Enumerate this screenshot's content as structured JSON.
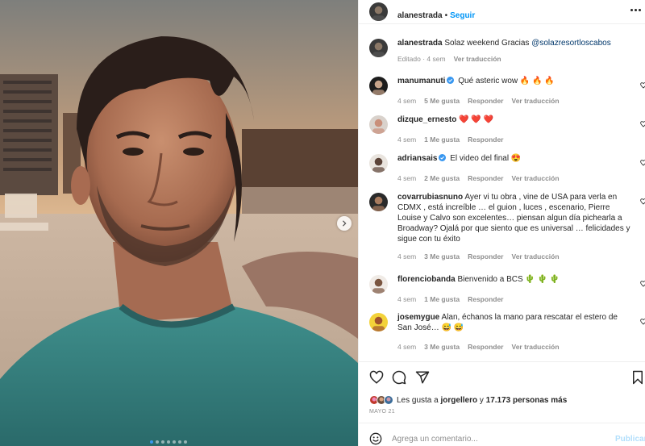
{
  "header": {
    "username": "alanestrada",
    "separator": "•",
    "follow_label": "Seguir"
  },
  "caption": {
    "username": "alanestrada",
    "text": "Solaz weekend Gracias",
    "mention": "@solazresortloscabos",
    "edited": "Editado",
    "time": "4 sem",
    "translate": "Ver traducción"
  },
  "comments": [
    {
      "username": "manumanuti",
      "verified": true,
      "text": "Qué asteric wow 🔥 🔥 🔥",
      "time": "4 sem",
      "likes": "5 Me gusta",
      "reply": "Responder",
      "translate": "Ver traducción"
    },
    {
      "username": "dizque_ernesto",
      "verified": false,
      "text": "❤️ ❤️ ❤️",
      "time": "4 sem",
      "likes": "1 Me gusta",
      "reply": "Responder",
      "translate": ""
    },
    {
      "username": "adriansais",
      "verified": true,
      "text": "El video del final 😍",
      "time": "4 sem",
      "likes": "2 Me gusta",
      "reply": "Responder",
      "translate": "Ver traducción"
    },
    {
      "username": "covarrubiasnuno",
      "verified": false,
      "text": "Ayer vi tu obra , vine de USA para verla en CDMX , está increíble … el guion , luces , escenario, Pierre Louise y Calvo son excelentes… piensan algun día pichearla a Broadway? Ojalá por que siento que es universal … felicidades y sigue con tu éxito",
      "time": "4 sem",
      "likes": "3 Me gusta",
      "reply": "Responder",
      "translate": "Ver traducción"
    },
    {
      "username": "florenciobanda",
      "verified": false,
      "text": "Bienvenido a BCS 🌵 🌵 🌵",
      "time": "4 sem",
      "likes": "1 Me gusta",
      "reply": "Responder",
      "translate": ""
    },
    {
      "username": "josemygue",
      "verified": false,
      "text": "Alan, échanos la mano para rescatar el estero de San José… 😅 😅",
      "time": "4 sem",
      "likes": "3 Me gusta",
      "reply": "Responder",
      "translate": "Ver traducción"
    }
  ],
  "likes_line": {
    "prefix": "Les gusta a",
    "user": "jorgellero",
    "middle": "y",
    "count": "17.173 personas más"
  },
  "date": "MAYO 21",
  "add_comment": {
    "placeholder": "Agrega un comentario...",
    "publish": "Publicar"
  },
  "carousel": {
    "total": 7,
    "active": 0
  },
  "icons": {
    "next": "chevron-right-icon",
    "like": "heart-icon",
    "comment": "speech-bubble-icon",
    "share": "paper-plane-icon",
    "save": "bookmark-icon",
    "emoji": "smiley-icon",
    "verified": "verified-badge-icon",
    "more": "more-options-icon"
  },
  "colors": {
    "link": "#0095f6",
    "muted": "#8e8e8e",
    "verified": "#3897f0",
    "publish_disabled": "#b2dffc"
  }
}
